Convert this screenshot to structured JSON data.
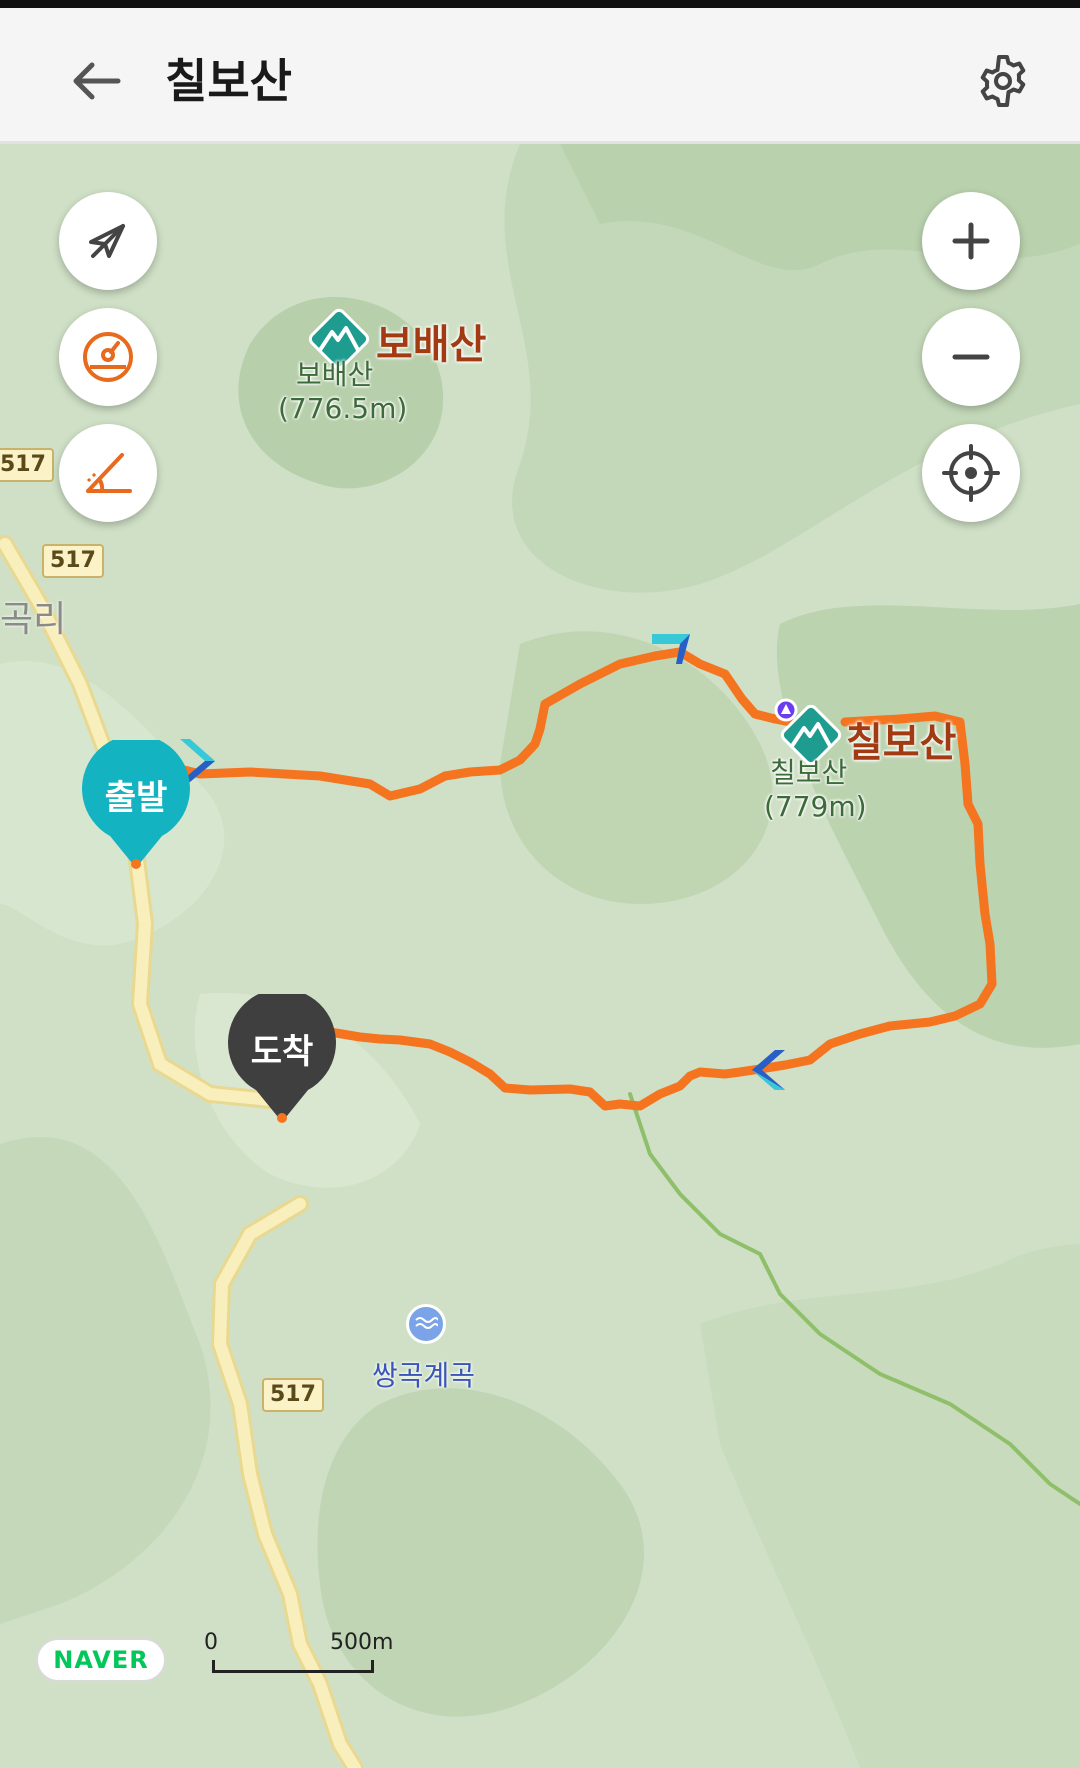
{
  "header": {
    "title": "칠보산"
  },
  "map_controls": {
    "left": [
      "compass-off-icon",
      "speedometer-icon",
      "slope-icon"
    ],
    "right": [
      "zoom-in-icon",
      "zoom-out-icon",
      "locate-icon"
    ]
  },
  "peaks": [
    {
      "label": "보배산",
      "name": "보배산",
      "elevation": "(776.5m)"
    },
    {
      "label": "칠보산",
      "name": "칠보산",
      "elevation": "(779m)"
    }
  ],
  "places": {
    "village": "곡리",
    "valley": "쌍곡계곡"
  },
  "roads": [
    "517",
    "517",
    "517"
  ],
  "pins": {
    "start": "출발",
    "end": "도착"
  },
  "brand": "NAVER",
  "scale": {
    "zero": "0",
    "distance": "500m"
  },
  "colors": {
    "route": "#f5741f",
    "start_pin": "#14b3c2",
    "end_pin": "#3f3f3f",
    "peak_label": "#a23a12",
    "trail": "#8fbf6a"
  }
}
